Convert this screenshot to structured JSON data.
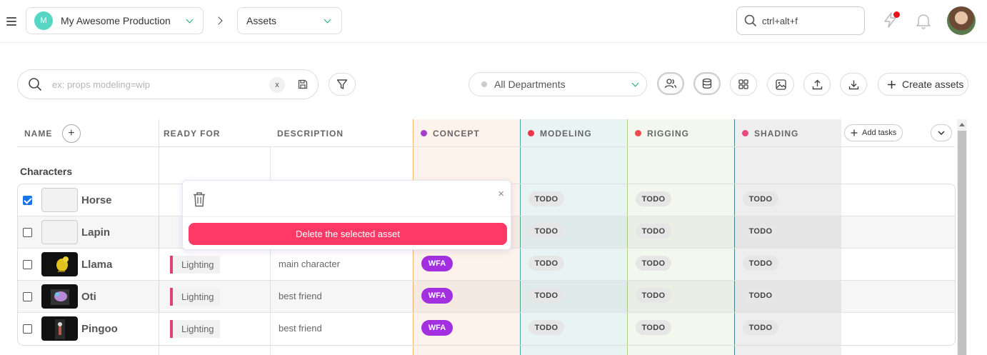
{
  "topbar": {
    "production_initial": "M",
    "production_name": "My Awesome Production",
    "section": "Assets",
    "search_placeholder": "ctrl+alt+f"
  },
  "filters": {
    "search_placeholder": "ex: props modeling=wip",
    "clear_label": "x",
    "department": "All Departments",
    "create_label": "Create assets"
  },
  "table": {
    "columns": {
      "name": "NAME",
      "ready_for": "READY FOR",
      "description": "DESCRIPTION",
      "add_tasks": "Add tasks"
    },
    "tasks": [
      {
        "name": "CONCEPT",
        "color": "#a53ec8"
      },
      {
        "name": "MODELING",
        "color": "#e8354a"
      },
      {
        "name": "RIGGING",
        "color": "#ee4a50"
      },
      {
        "name": "SHADING",
        "color": "#e8487e"
      }
    ],
    "group": "Characters",
    "rows": [
      {
        "name": "Horse",
        "checked": true,
        "ready": "",
        "description": "",
        "concept": "",
        "modeling": "TODO",
        "rigging": "TODO",
        "shading": "TODO"
      },
      {
        "name": "Lapin",
        "checked": false,
        "ready": "",
        "description": "",
        "concept": "",
        "modeling": "TODO",
        "rigging": "TODO",
        "shading": "TODO"
      },
      {
        "name": "Llama",
        "checked": false,
        "ready": "Lighting",
        "description": "main character",
        "concept": "WFA",
        "modeling": "TODO",
        "rigging": "TODO",
        "shading": "TODO"
      },
      {
        "name": "Oti",
        "checked": false,
        "ready": "Lighting",
        "description": "best friend",
        "concept": "WFA",
        "modeling": "TODO",
        "rigging": "TODO",
        "shading": "TODO"
      },
      {
        "name": "Pingoo",
        "checked": false,
        "ready": "Lighting",
        "description": "best friend",
        "concept": "WFA",
        "modeling": "TODO",
        "rigging": "TODO",
        "shading": "TODO"
      }
    ]
  },
  "popup": {
    "close_label": "×",
    "delete_label": "Delete the selected asset"
  },
  "colors": {
    "delete_button": "#fe3966",
    "wfa": "#a230e0",
    "accent_green": "#18a978"
  }
}
